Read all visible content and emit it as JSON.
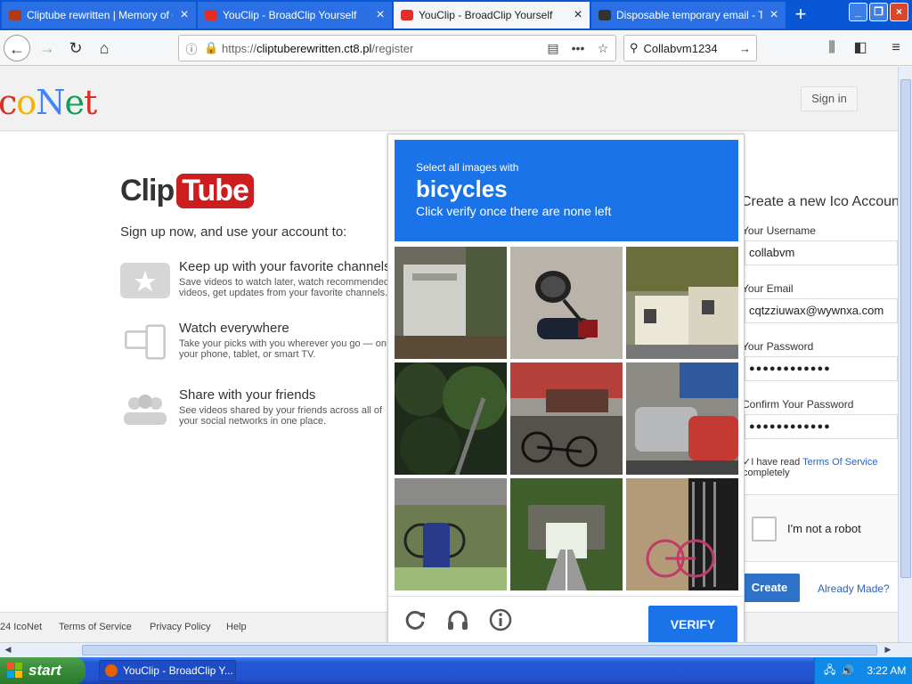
{
  "browser": {
    "tabs": [
      {
        "title": "Cliptube rewritten | Memory of Ol",
        "icon": "film-icon"
      },
      {
        "title": "YouClip - BroadClip Yourself",
        "icon": "youtube-icon"
      },
      {
        "title": "YouClip - BroadClip Yourself",
        "icon": "youtube-icon",
        "active": true
      },
      {
        "title": "Disposable temporary email - Tem",
        "icon": "tmail-icon"
      }
    ],
    "url_prefix": "https://",
    "url_domain": "cliptuberewritten.ct8.pl",
    "url_path": "/register",
    "search_value": "Collabvm1234"
  },
  "site": {
    "logo": {
      "p1": "c",
      "p2": "o",
      "p3": "N",
      "p4": "e",
      "p5": "t"
    },
    "signin_label": "Sign in",
    "clip": "Clip",
    "tube": "Tube",
    "tagline": "Sign up now, and use your account to:",
    "features": [
      {
        "title": "Keep up with your favorite channels",
        "desc": "Save videos to watch later, watch recommended videos, get updates from your favorite channels."
      },
      {
        "title": "Watch everywhere",
        "desc": "Take your picks with you wherever you go — on your phone, tablet, or smart TV."
      },
      {
        "title": "Share with your friends",
        "desc": "See videos shared by your friends across all of your social networks in one place."
      }
    ],
    "footer": {
      "copyright": "24 IcoNet",
      "terms": "Terms of Service",
      "privacy": "Privacy Policy",
      "help": "Help"
    }
  },
  "form": {
    "title": "Create a new Ico Account",
    "username_label": "Your Username",
    "username_value": "collabvm",
    "email_label": "Your Email",
    "email_value": "cqtzziuwax@wywnxa.com",
    "password_label": "Your Password",
    "password_value": "●●●●●●●●●●●●",
    "confirm_label": "Confirm Your Password",
    "confirm_value": "●●●●●●●●●●●●",
    "terms_prefix": "I have read ",
    "terms_link": "Terms Of Service",
    "terms_suffix": "completely",
    "recaptcha_label": "I'm not a robot",
    "create_label": "Create",
    "already_label": "Already Made?"
  },
  "captcha": {
    "select_text": "Select all images with",
    "target": "bicycles",
    "instruction": "Click verify once there are none left",
    "verify_label": "VERIFY"
  },
  "taskbar": {
    "start_label": "start",
    "task_item": "YouClip - BroadClip Y...",
    "clock": "3:22 AM"
  }
}
